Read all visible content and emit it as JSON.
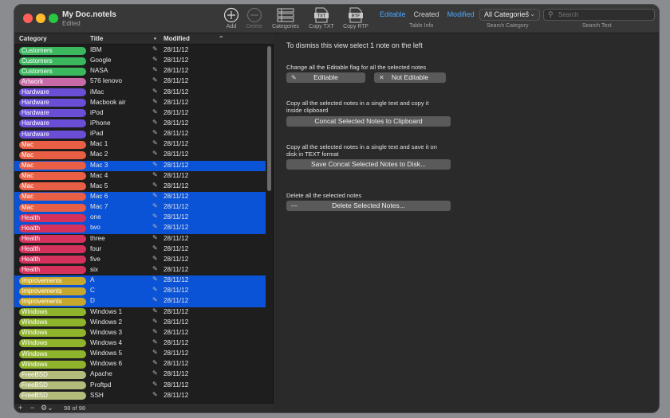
{
  "window": {
    "title": "My Doc.notels",
    "subtitle": "Edited"
  },
  "toolbar": {
    "add": "Add",
    "delete": "Delete",
    "categories": "Categories",
    "copy_txt": "Copy TXT",
    "copy_rtf": "Copy RTF",
    "table_info": {
      "options": [
        "Editable",
        "Created",
        "Modified"
      ],
      "caption": "Table Info"
    },
    "category_select": {
      "value": "All Categories",
      "caption": "Search Category"
    },
    "search": {
      "placeholder": "Search",
      "caption": "Search Text"
    }
  },
  "colors": {
    "Customers": "#3bb75e",
    "Artwork": "#c86aa8",
    "Hardware": "#6a4ed6",
    "Mac": "#e85f45",
    "Health": "#d4325c",
    "Improvements": "#c8a82c",
    "Windows": "#8fb42c",
    "FreeBSD": "#b4bc7c",
    "selection": "#0a52d6"
  },
  "table": {
    "headers": {
      "category": "Category",
      "title": "Title",
      "dot": "•",
      "modified": "Modified"
    },
    "rows": [
      {
        "category": "Customers",
        "title": "IBM",
        "date": "28/11/12",
        "selected": false
      },
      {
        "category": "Customers",
        "title": "Google",
        "date": "28/11/12",
        "selected": false
      },
      {
        "category": "Customers",
        "title": "NASA",
        "date": "28/11/12",
        "selected": false
      },
      {
        "category": "Artwork",
        "title": "576 lenovo",
        "date": "28/11/12",
        "selected": false
      },
      {
        "category": "Hardware",
        "title": "iMac",
        "date": "28/11/12",
        "selected": false
      },
      {
        "category": "Hardware",
        "title": "Macbook air",
        "date": "28/11/12",
        "selected": false
      },
      {
        "category": "Hardware",
        "title": "iPod",
        "date": "28/11/12",
        "selected": false
      },
      {
        "category": "Hardware",
        "title": "iPhone",
        "date": "28/11/12",
        "selected": false
      },
      {
        "category": "Hardware",
        "title": "iPad",
        "date": "28/11/12",
        "selected": false
      },
      {
        "category": "Mac",
        "title": "Mac 1",
        "date": "28/11/12",
        "selected": false
      },
      {
        "category": "Mac",
        "title": "Mac 2",
        "date": "28/11/12",
        "selected": false
      },
      {
        "category": "Mac",
        "title": "Mac 3",
        "date": "28/11/12",
        "selected": true
      },
      {
        "category": "Mac",
        "title": "Mac 4",
        "date": "28/11/12",
        "selected": false
      },
      {
        "category": "Mac",
        "title": "Mac 5",
        "date": "28/11/12",
        "selected": false
      },
      {
        "category": "Mac",
        "title": "Mac 6",
        "date": "28/11/12",
        "selected": true
      },
      {
        "category": "Mac",
        "title": "Mac 7",
        "date": "28/11/12",
        "selected": true
      },
      {
        "category": "Health",
        "title": "one",
        "date": "28/11/12",
        "selected": true
      },
      {
        "category": "Health",
        "title": "two",
        "date": "28/11/12",
        "selected": true
      },
      {
        "category": "Health",
        "title": "three",
        "date": "28/11/12",
        "selected": false
      },
      {
        "category": "Health",
        "title": "four",
        "date": "28/11/12",
        "selected": false
      },
      {
        "category": "Health",
        "title": "five",
        "date": "28/11/12",
        "selected": false
      },
      {
        "category": "Health",
        "title": "six",
        "date": "28/11/12",
        "selected": false
      },
      {
        "category": "Improvements",
        "title": "A",
        "date": "28/11/12",
        "selected": true
      },
      {
        "category": "Improvements",
        "title": "C",
        "date": "28/11/12",
        "selected": true
      },
      {
        "category": "Improvements",
        "title": "D",
        "date": "28/11/12",
        "selected": true
      },
      {
        "category": "Windows",
        "title": "Windows 1",
        "date": "28/11/12",
        "selected": false
      },
      {
        "category": "Windows",
        "title": "Windows 2",
        "date": "28/11/12",
        "selected": false
      },
      {
        "category": "Windows",
        "title": "Windows 3",
        "date": "28/11/12",
        "selected": false
      },
      {
        "category": "Windows",
        "title": "Windows 4",
        "date": "28/11/12",
        "selected": false
      },
      {
        "category": "Windows",
        "title": "Windows 5",
        "date": "28/11/12",
        "selected": false
      },
      {
        "category": "Windows",
        "title": "Windows 6",
        "date": "28/11/12",
        "selected": false
      },
      {
        "category": "FreeBSD",
        "title": "Apache",
        "date": "28/11/12",
        "selected": false
      },
      {
        "category": "FreeBSD",
        "title": "Proftpd",
        "date": "28/11/12",
        "selected": false
      },
      {
        "category": "FreeBSD",
        "title": "SSH",
        "date": "28/11/12",
        "selected": false
      }
    ],
    "footer": {
      "add": "+",
      "remove": "−",
      "count": "98 of 98"
    }
  },
  "detail": {
    "dismiss": "To dismiss this view select 1 note on the left",
    "editable_text": "Change all the Editable flag for all the selected notes",
    "editable_button": "Editable",
    "not_editable_button": "Not Editable",
    "copy_text_1": "Copy all the selected notes in a single text and copy it",
    "copy_text_2": "inside clipboard",
    "concat_clipboard_button": "Concat Selected Notes to Clipboard",
    "save_text_1": "Copy all the selected notes in a single text and save it on",
    "save_text_2": "disk in TEXT format",
    "save_disk_button": "Save Concat Selected Notes to Disk...",
    "delete_text": "Delete all the selected notes",
    "delete_button": "Delete Selected Notes..."
  }
}
